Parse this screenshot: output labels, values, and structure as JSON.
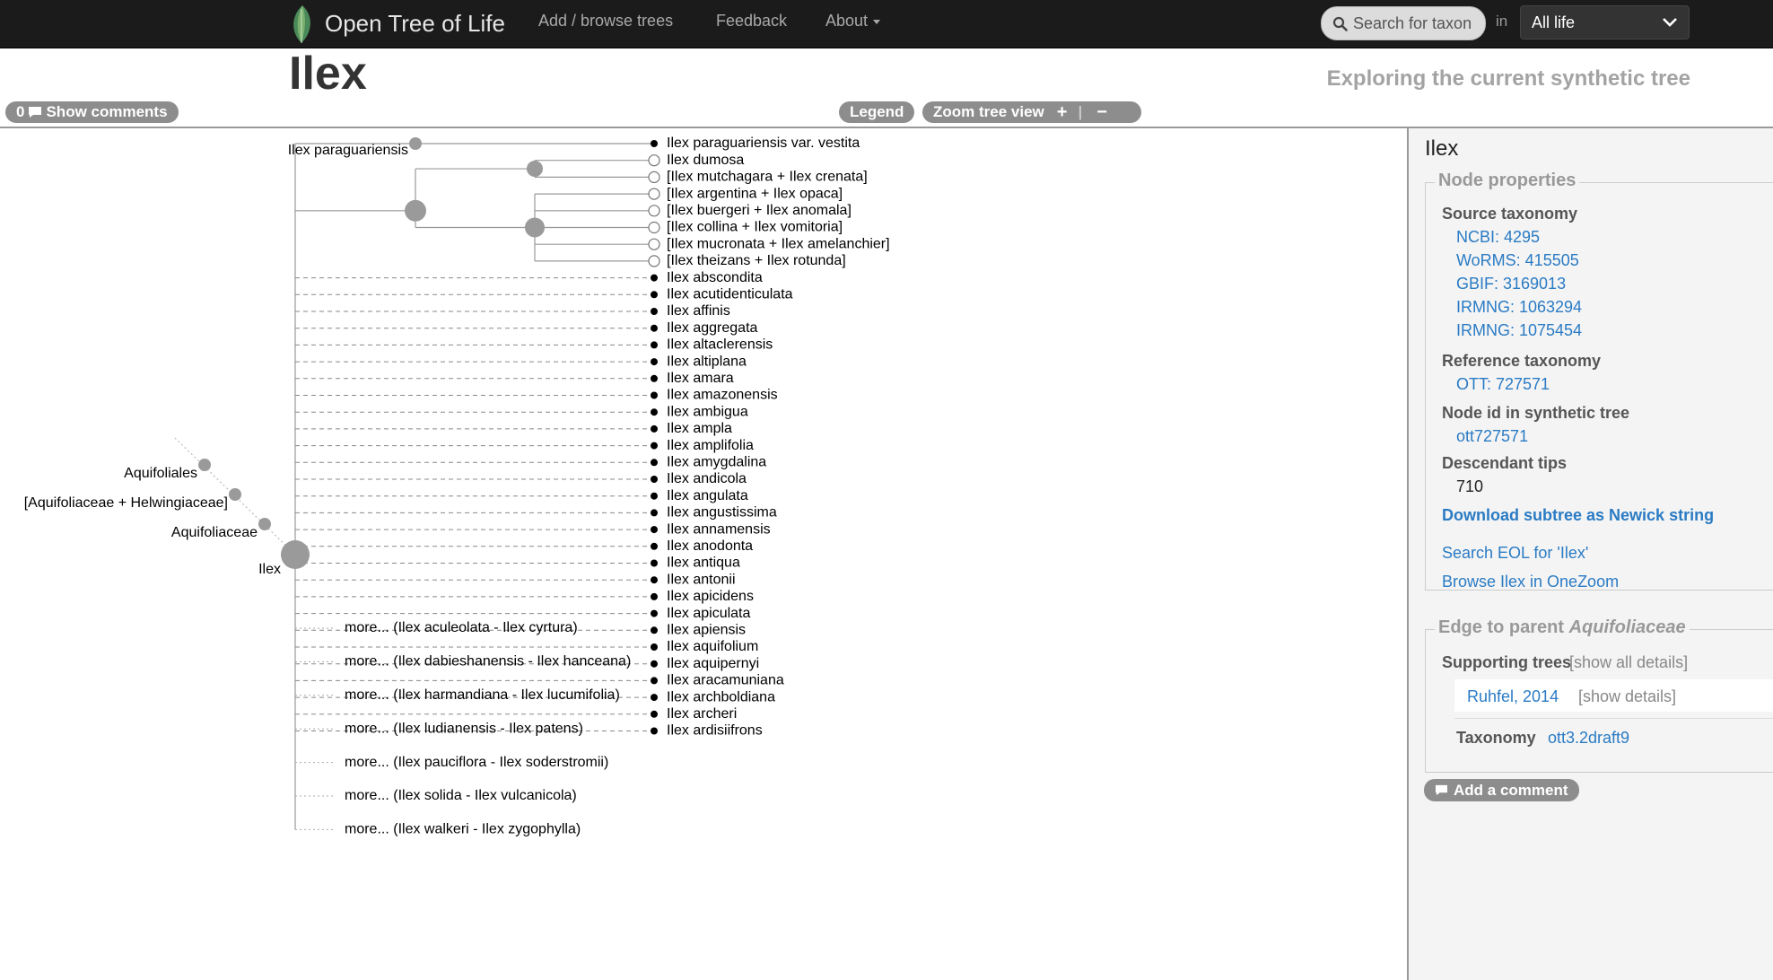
{
  "nav": {
    "brand": "Open Tree of Life",
    "items": [
      {
        "label": "Add / browse trees"
      },
      {
        "label": "Feedback"
      },
      {
        "label": "About"
      }
    ],
    "search_placeholder": "Search for taxon",
    "in_label": "in",
    "scope_value": "All life"
  },
  "header": {
    "title": "Ilex",
    "subtitle": "Exploring the current synthetic tree",
    "comments_count": "0",
    "comments_label": "Show comments",
    "legend_label": "Legend",
    "zoom_label": "Zoom tree view"
  },
  "tree": {
    "ancestors": [
      "Aquifoliales",
      "[Aquifoliaceae + Helwingiaceae]",
      "Aquifoliaceae"
    ],
    "focal": "Ilex",
    "internal_label": "Ilex paraguariensis",
    "resolved_tips": [
      {
        "label": "Ilex paraguariensis var. vestita",
        "kind": "leaf"
      },
      {
        "label": "Ilex dumosa",
        "kind": "collapsed"
      },
      {
        "label": "[Ilex mutchagara + Ilex crenata]",
        "kind": "collapsed"
      },
      {
        "label": "[Ilex argentina + Ilex opaca]",
        "kind": "collapsed"
      },
      {
        "label": "[Ilex buergeri + Ilex anomala]",
        "kind": "collapsed"
      },
      {
        "label": "[Ilex collina + Ilex vomitoria]",
        "kind": "collapsed"
      },
      {
        "label": "[Ilex mucronata + Ilex amelanchier]",
        "kind": "collapsed"
      },
      {
        "label": "[Ilex theizans + Ilex rotunda]",
        "kind": "collapsed"
      }
    ],
    "unresolved_tips": [
      "Ilex abscondita",
      "Ilex acutidenticulata",
      "Ilex affinis",
      "Ilex aggregata",
      "Ilex altaclerensis",
      "Ilex altiplana",
      "Ilex amara",
      "Ilex amazonensis",
      "Ilex ambigua",
      "Ilex ampla",
      "Ilex amplifolia",
      "Ilex amygdalina",
      "Ilex andicola",
      "Ilex angulata",
      "Ilex angustissima",
      "Ilex annamensis",
      "Ilex anodonta",
      "Ilex antiqua",
      "Ilex antonii",
      "Ilex apicidens",
      "Ilex apiculata",
      "Ilex apiensis",
      "Ilex aquifolium",
      "Ilex aquipernyi",
      "Ilex aracamuniana",
      "Ilex archboldiana",
      "Ilex archeri",
      "Ilex ardisiifrons"
    ],
    "more_links": [
      "more... (Ilex aculeolata - Ilex cyrtura)",
      "more... (Ilex dabieshanensis - Ilex hanceana)",
      "more... (Ilex harmandiana - Ilex lucumifolia)",
      "more... (Ilex ludianensis - Ilex patens)",
      "more... (Ilex pauciflora - Ilex soderstromii)",
      "more... (Ilex solida - Ilex vulcanicola)",
      "more... (Ilex walkeri - Ilex zygophylla)"
    ]
  },
  "panel": {
    "title": "Ilex",
    "node_props_legend": "Node properties",
    "source_taxonomy_h": "Source taxonomy",
    "sources": [
      "NCBI: 4295",
      "WoRMS: 415505",
      "GBIF: 3169013",
      "IRMNG: 1063294",
      "IRMNG: 1075454"
    ],
    "reference_h": "Reference taxonomy",
    "reference": "OTT: 727571",
    "node_id_h": "Node id in synthetic tree",
    "node_id": "ott727571",
    "desc_h": "Descendant tips",
    "desc_val": "710",
    "download": "Download subtree as Newick string",
    "eol": "Search EOL for 'Ilex'",
    "onezoom": "Browse Ilex in OneZoom",
    "edge_legend_prefix": "Edge to parent ",
    "edge_legend_taxon": "Aquifoliaceae",
    "supporting_h": "Supporting trees",
    "show_all": "[show all details]",
    "tree_ref": "Ruhfel, 2014",
    "show_details": "[show details]",
    "taxonomy_h": "Taxonomy",
    "taxonomy_val": "ott3.2draft9",
    "add_comment": "Add a comment"
  },
  "colors": {
    "link": "#2a7bc4",
    "node": "#9a9a9a",
    "topbar": "#1b1b1b"
  }
}
